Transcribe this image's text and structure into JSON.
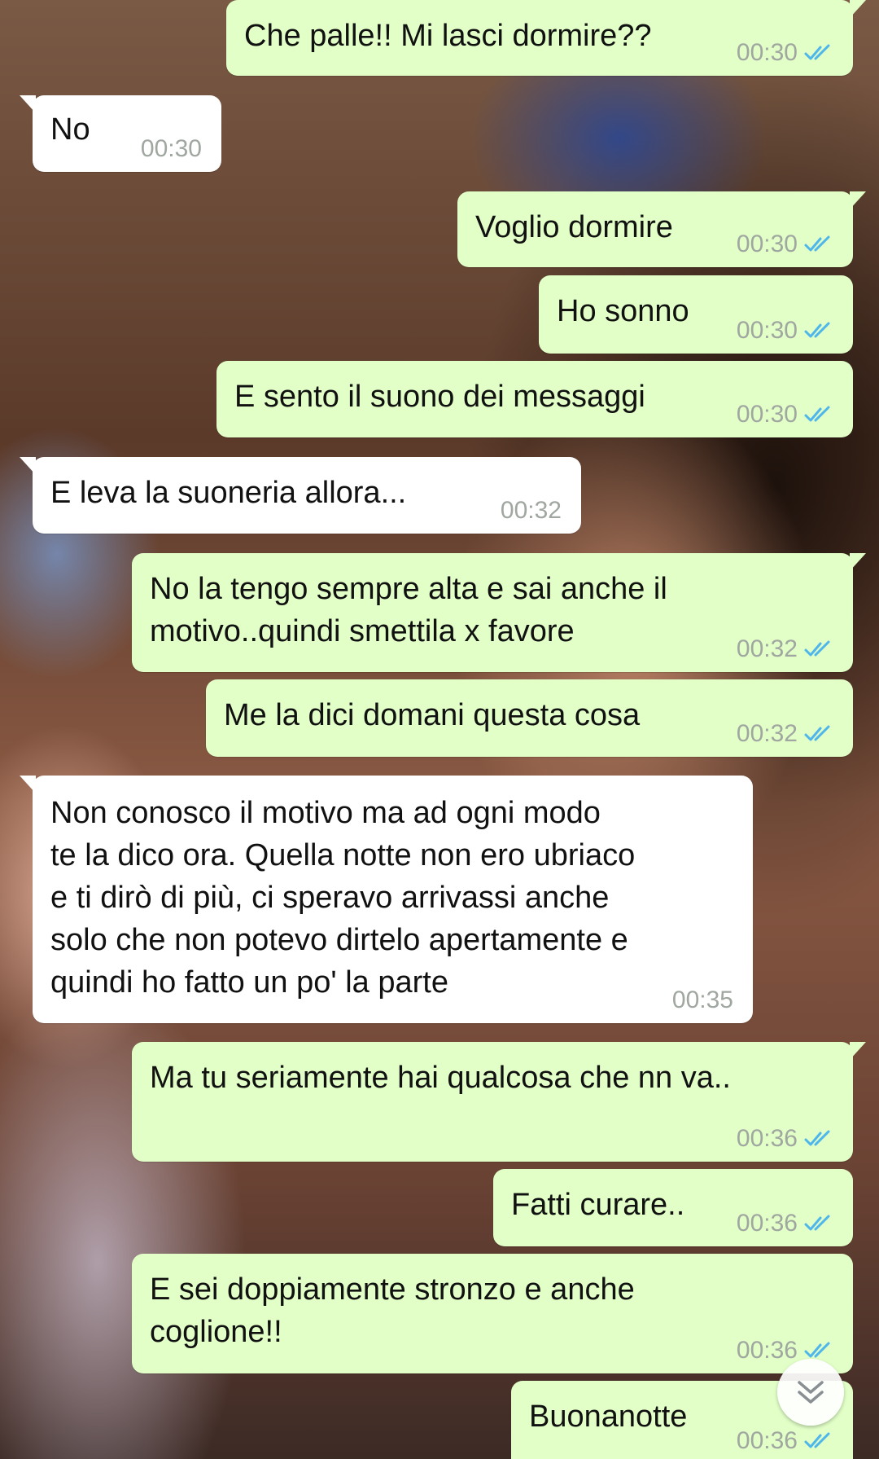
{
  "conversation": {
    "messages": [
      {
        "direction": "out",
        "text": "Che palle!! Mi lasci dormire??",
        "time": "00:30",
        "status": "read"
      },
      {
        "direction": "in",
        "text": "No",
        "time": "00:30"
      },
      {
        "direction": "out",
        "text": "Voglio dormire",
        "time": "00:30",
        "status": "read"
      },
      {
        "direction": "out",
        "text": "Ho sonno",
        "time": "00:30",
        "status": "read"
      },
      {
        "direction": "out",
        "text": "E sento il suono dei messaggi",
        "time": "00:30",
        "status": "read"
      },
      {
        "direction": "in",
        "text": "E leva la suoneria allora...",
        "time": "00:32"
      },
      {
        "direction": "out",
        "text": "No la tengo sempre alta e sai anche il\nmotivo..quindi smettila x favore",
        "time": "00:32",
        "status": "read"
      },
      {
        "direction": "out",
        "text": "Me la dici domani questa cosa",
        "time": "00:32",
        "status": "read"
      },
      {
        "direction": "in",
        "text": "Non conosco il motivo ma ad ogni modo\nte la dico ora. Quella notte non ero ubriaco\ne ti dirò di più, ci speravo arrivassi anche\nsolo che non potevo dirtelo apertamente e\nquindi ho fatto un po' la parte",
        "time": "00:35"
      },
      {
        "direction": "out",
        "text": "Ma tu seriamente hai qualcosa che nn va..",
        "time": "00:36",
        "status": "read"
      },
      {
        "direction": "out",
        "text": "Fatti curare..",
        "time": "00:36",
        "status": "read"
      },
      {
        "direction": "out",
        "text": "E sei doppiamente stronzo e anche\ncoglione!!",
        "time": "00:36",
        "status": "read"
      },
      {
        "direction": "out",
        "text": "Buonanotte",
        "time": "00:36",
        "status": "read"
      }
    ]
  },
  "scroll_button": {
    "icon": "double-chevron-down-icon"
  },
  "colors": {
    "outgoing_bubble": "#e1ffc7",
    "incoming_bubble": "#ffffff",
    "read_ticks": "#4fb6ec",
    "timestamp": "#a0a6a0"
  }
}
